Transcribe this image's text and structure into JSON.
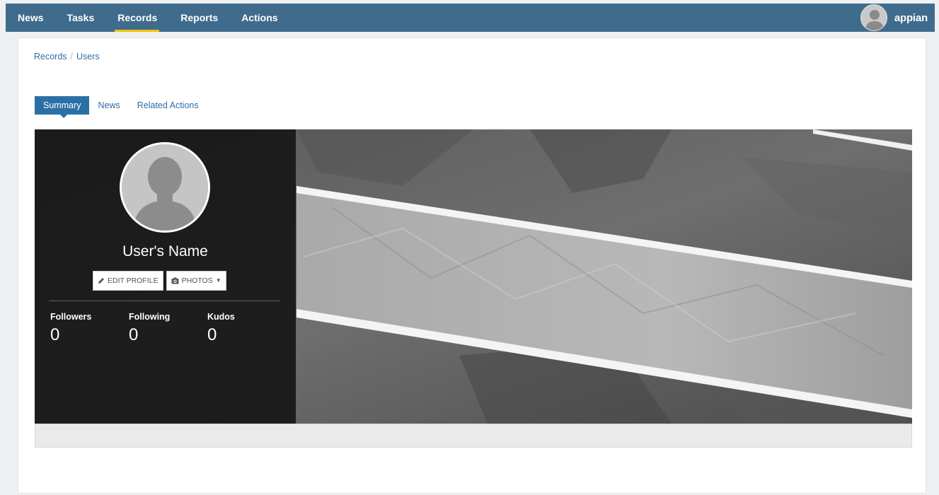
{
  "nav": {
    "items": [
      "News",
      "Tasks",
      "Records",
      "Reports",
      "Actions"
    ],
    "active": "Records"
  },
  "account": {
    "brand": "appian",
    "avatar_icon": "user-avatar-icon"
  },
  "breadcrumb": {
    "items": [
      "Records",
      "Users"
    ],
    "separator": "/"
  },
  "tabs": {
    "items": [
      "Summary",
      "News",
      "Related Actions"
    ],
    "active": "Summary"
  },
  "profile": {
    "name": "User's Name",
    "edit_label": "EDIT PROFILE",
    "photos_label": "PHOTOS",
    "stats": [
      {
        "label": "Followers",
        "value": "0"
      },
      {
        "label": "Following",
        "value": "0"
      },
      {
        "label": "Kudos",
        "value": "0"
      }
    ]
  },
  "colors": {
    "nav_bg": "#3f6b8d",
    "nav_active_underline": "#f2c500",
    "tab_active_bg": "#2b70a5",
    "link": "#2e6da4"
  }
}
